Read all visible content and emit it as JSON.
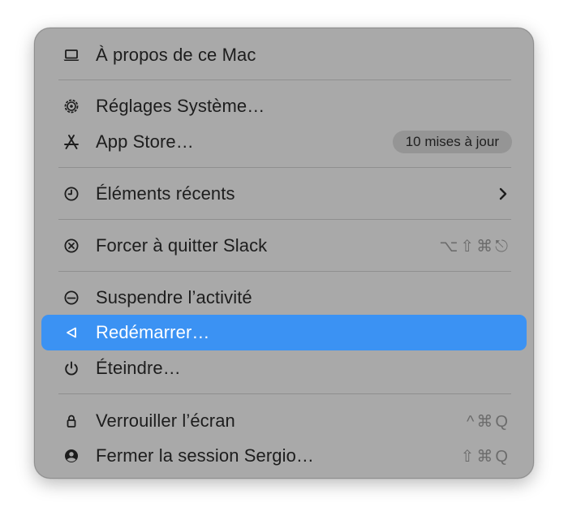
{
  "menu": {
    "about": {
      "label": "À propos de ce Mac",
      "icon": "laptop-icon"
    },
    "settings": {
      "label": "Réglages Système…",
      "icon": "gear-icon"
    },
    "appstore": {
      "label": "App Store…",
      "icon": "app-store-icon",
      "badge": "10 mises à jour"
    },
    "recent": {
      "label": "Éléments récents",
      "icon": "clock-icon",
      "submenu_icon": "chevron-right-icon"
    },
    "force_quit": {
      "label": "Forcer à quitter Slack",
      "icon": "x-circle-icon",
      "shortcut": "⌥⇧⌘⎋"
    },
    "sleep": {
      "label": "Suspendre l’activité",
      "icon": "sleep-icon"
    },
    "restart": {
      "label": "Redémarrer…",
      "icon": "restart-triangle-icon",
      "selected": true
    },
    "shutdown": {
      "label": "Éteindre…",
      "icon": "power-icon"
    },
    "lock": {
      "label": "Verrouiller l’écran",
      "icon": "lock-icon",
      "shortcut": "^⌘Q"
    },
    "logout": {
      "label": "Fermer la session Sergio…",
      "icon": "user-circle-icon",
      "shortcut": "⇧⌘Q"
    }
  },
  "colors": {
    "menu_background": "#a9a9a9",
    "selection": "#3b92f3",
    "text": "#1d1d1d",
    "shortcut_text": "#6c6c6c",
    "badge_background": "#959595",
    "separator": "#8f8f8f"
  }
}
